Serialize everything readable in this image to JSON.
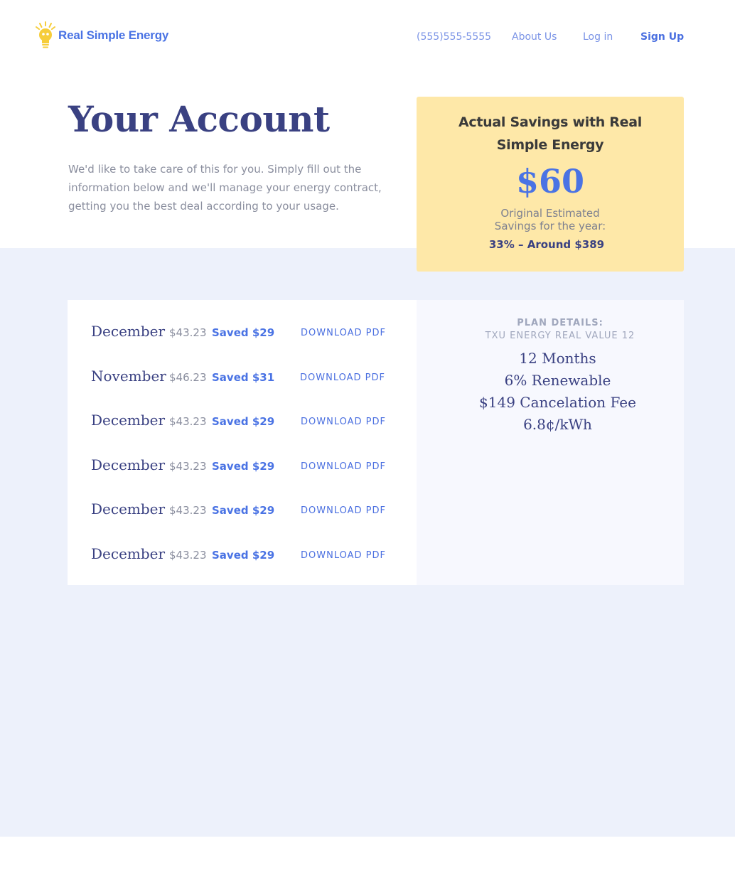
{
  "brand": {
    "name": "Real Simple Energy",
    "accent_color": "#4a73e4",
    "logo_color": "#f6cd3a"
  },
  "nav": {
    "phone": "(555)555-5555",
    "about": "About Us",
    "login": "Log in",
    "signup": "Sign Up"
  },
  "hero": {
    "title": "Your Account",
    "intro": "We'd like to take care of this for you. Simply fill out the information below and we'll manage your energy contract, getting you the best deal according to your usage."
  },
  "savings": {
    "title": "Actual Savings with Real Simple Energy",
    "amount": "$60",
    "subtitle": "Original Estimated Savings for the year:",
    "percent_line": "33% – Around $389",
    "card_color": "#fee8a8"
  },
  "bills": [
    {
      "month": "December",
      "amount": "$43.23",
      "saved": "Saved $29",
      "action": "DOWNLOAD PDF"
    },
    {
      "month": "November",
      "amount": "$46.23",
      "saved": "Saved $31",
      "action": "DOWNLOAD PDF"
    },
    {
      "month": "December",
      "amount": "$43.23",
      "saved": "Saved $29",
      "action": "DOWNLOAD PDF"
    },
    {
      "month": "December",
      "amount": "$43.23",
      "saved": "Saved $29",
      "action": "DOWNLOAD PDF"
    },
    {
      "month": "December",
      "amount": "$43.23",
      "saved": "Saved $29",
      "action": "DOWNLOAD PDF"
    },
    {
      "month": "December",
      "amount": "$43.23",
      "saved": "Saved $29",
      "action": "DOWNLOAD PDF"
    }
  ],
  "plan": {
    "label": "PLAN DETAILS:",
    "name": "TXU ENERGY REAL VALUE 12",
    "details": [
      "12 Months",
      "6% Renewable",
      "$149 Cancelation Fee",
      "6.8¢/kWh"
    ]
  }
}
